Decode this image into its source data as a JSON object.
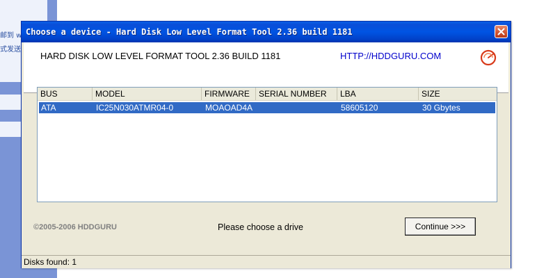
{
  "background": {
    "text_line_1": "邮到 w",
    "text_line_2": "式发送"
  },
  "window": {
    "title": "Choose a device - Hard Disk Low Level Format Tool 2.36 build 1181",
    "close_icon": "close-icon"
  },
  "header": {
    "title": "HARD DISK LOW LEVEL FORMAT TOOL 2.36 BUILD 1181",
    "link": "HTTP://HDDGURU.COM",
    "logo_icon": "hddguru-logo-icon"
  },
  "device_list": {
    "columns": [
      "BUS",
      "MODEL",
      "FIRMWARE",
      "SERIAL NUMBER",
      "LBA",
      "SIZE"
    ],
    "rows": [
      {
        "bus": "ATA",
        "model": "IC25N030ATMR04-0",
        "firmware": "MOAOAD4A",
        "serial": "",
        "lba": "58605120",
        "size": "30 Gbytes",
        "selected": true
      }
    ]
  },
  "footer": {
    "copyright": "©2005-2006 HDDGURU",
    "prompt": "Please choose a drive",
    "continue_label": "Continue >>>"
  },
  "status": {
    "text": "Disks found: 1"
  },
  "colors": {
    "titlebar": "#0054e3",
    "selection": "#316ac5",
    "dialog_bg": "#ece9d8",
    "link": "#0000cc"
  }
}
